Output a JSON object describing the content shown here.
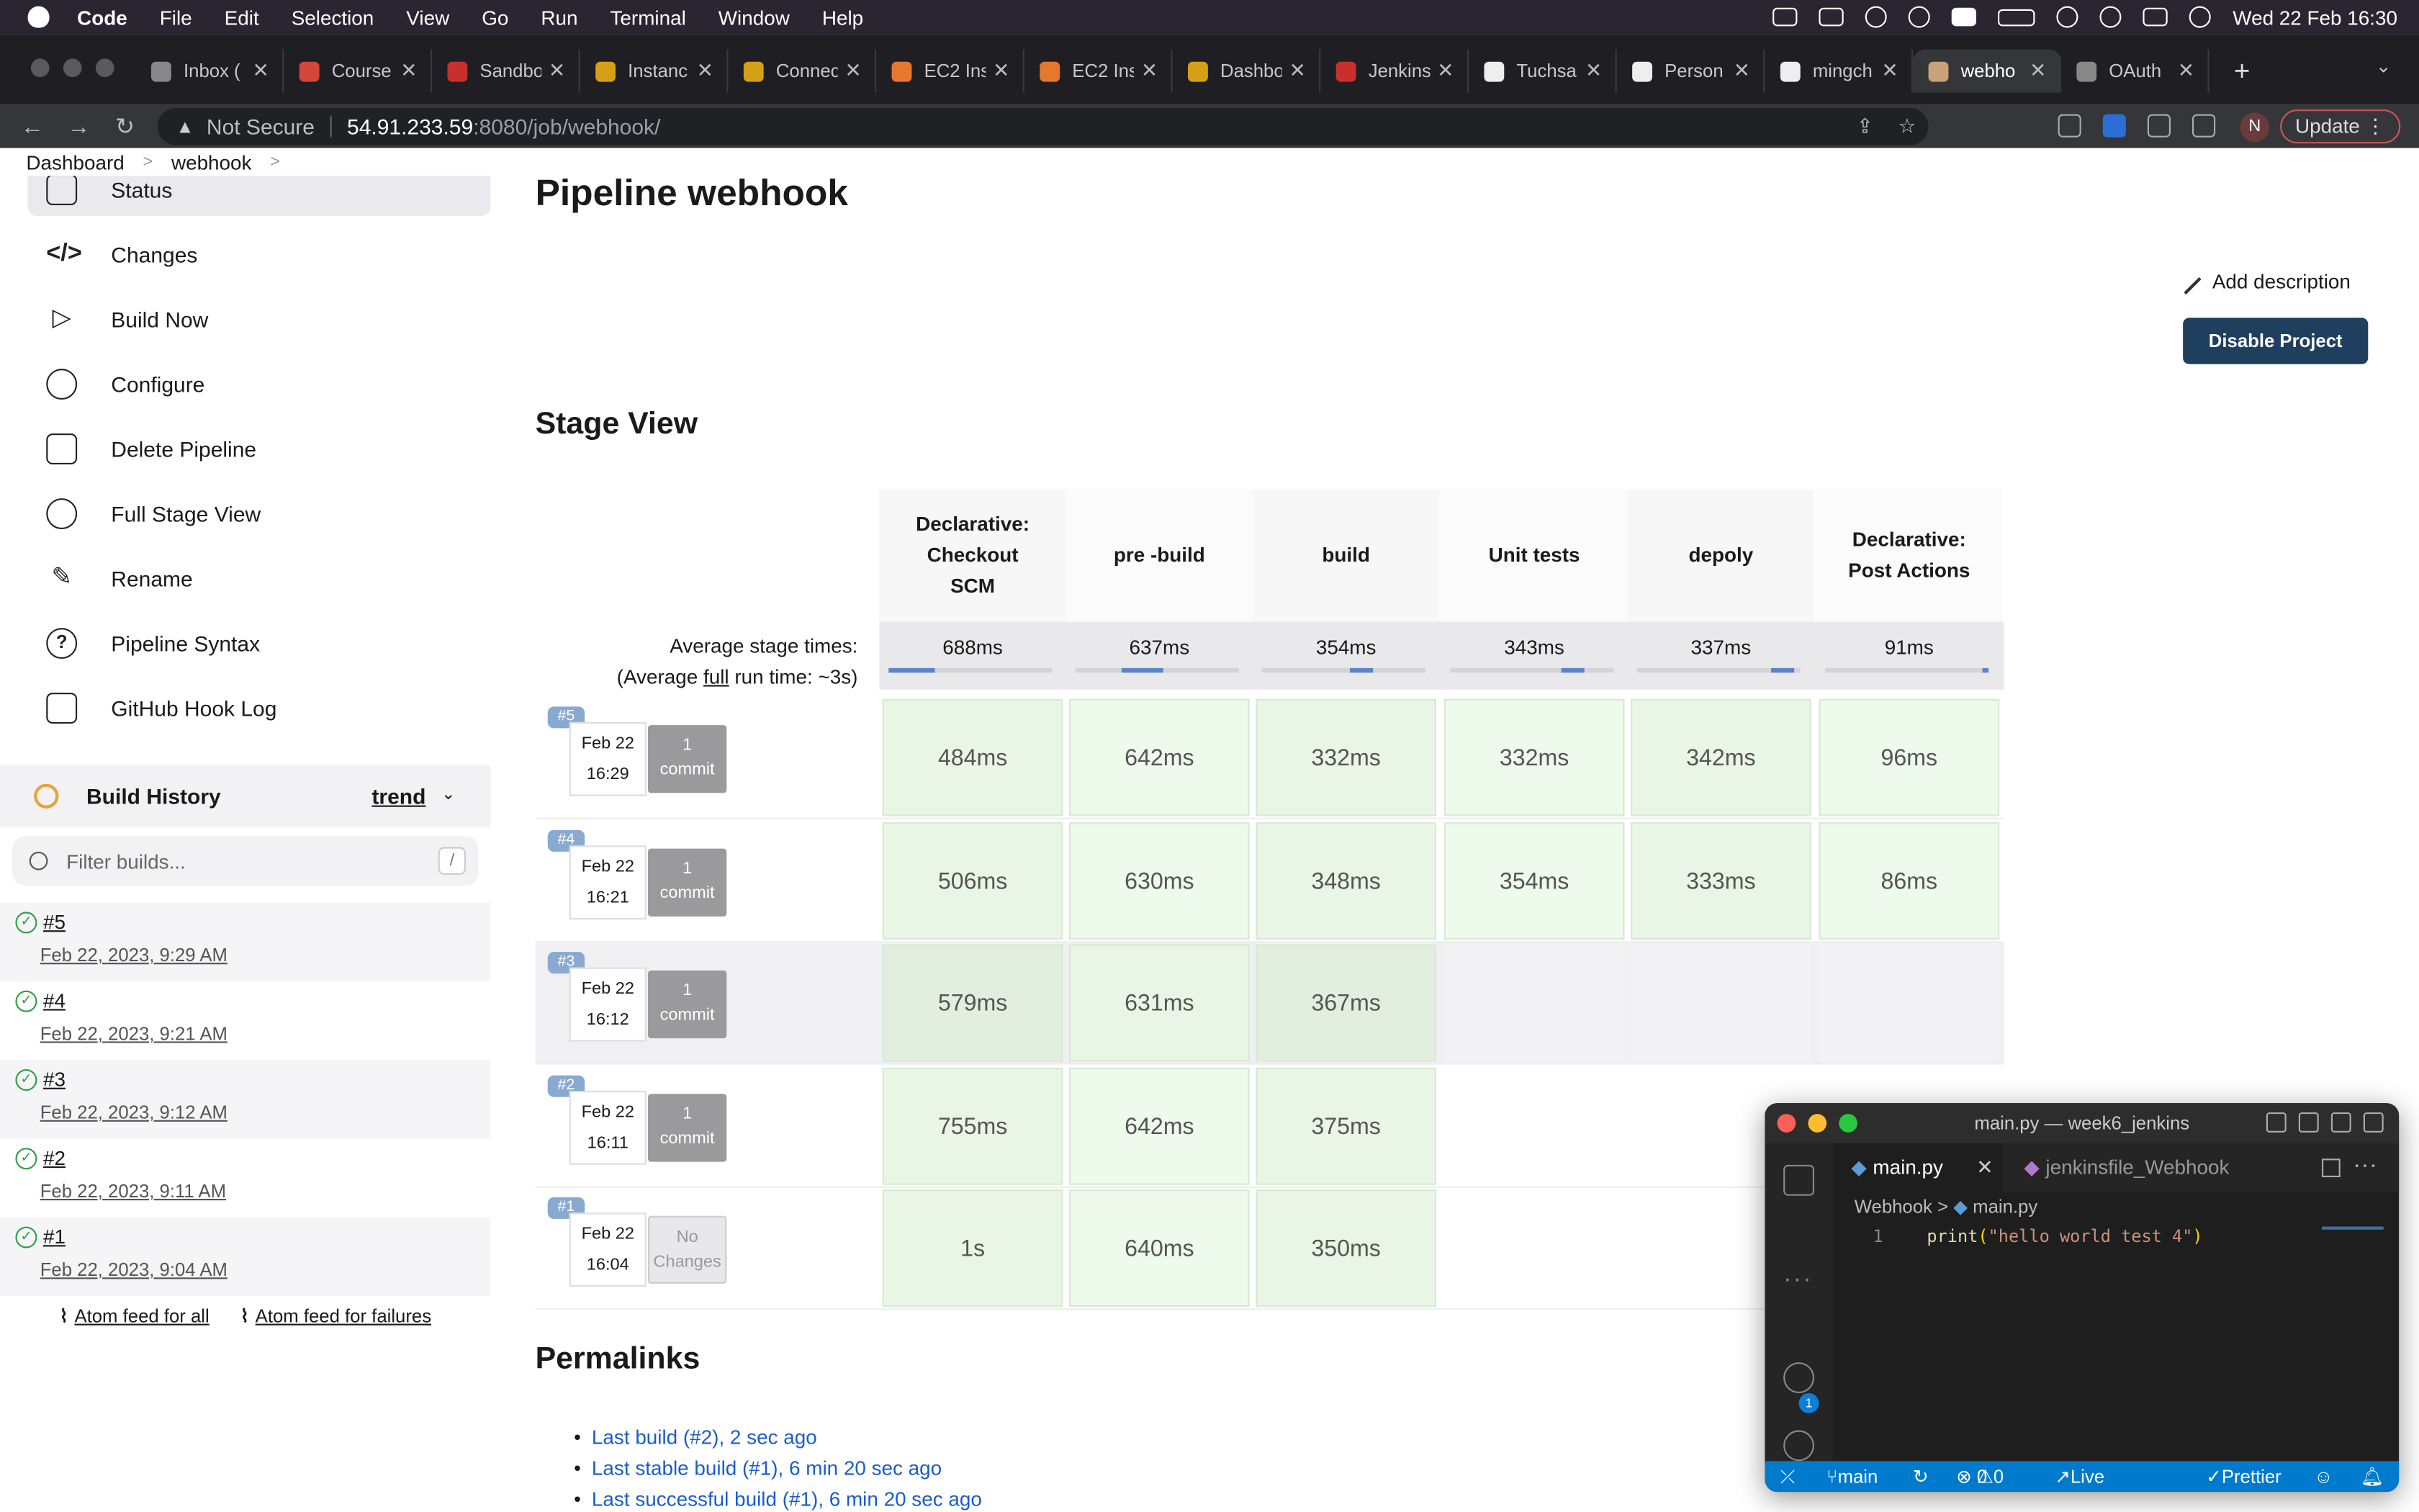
{
  "menubar": {
    "app": "Code",
    "items": [
      "File",
      "Edit",
      "Selection",
      "View",
      "Go",
      "Run",
      "Terminal",
      "Window",
      "Help"
    ],
    "clock": "Wed 22 Feb  16:30"
  },
  "browser": {
    "tabs": [
      {
        "label": "Inbox (",
        "color": "#888888"
      },
      {
        "label": "Course",
        "color": "#d44638"
      },
      {
        "label": "Sandbo",
        "color": "#c9302c"
      },
      {
        "label": "Instanc",
        "color": "#d4a017"
      },
      {
        "label": "Connec",
        "color": "#d4a017"
      },
      {
        "label": "EC2 Ins",
        "color": "#e8772e"
      },
      {
        "label": "EC2 Ins",
        "color": "#e8772e"
      },
      {
        "label": "Dashbo",
        "color": "#d4a017"
      },
      {
        "label": "Jenkins",
        "color": "#c9302c"
      },
      {
        "label": "Tuchsa",
        "color": "#eeeeee"
      },
      {
        "label": "Person",
        "color": "#eeeeee"
      },
      {
        "label": "mingch",
        "color": "#eeeeee"
      },
      {
        "label": "webho",
        "color": "#c9a27a",
        "active": true
      },
      {
        "label": "OAuth",
        "color": "#888888"
      }
    ],
    "security": "Not Secure",
    "url_host": "54.91.233.59",
    "url_path": ":8080/job/webhook/",
    "profile_initial": "N",
    "update_label": "Update"
  },
  "breadcrumb": [
    "Dashboard",
    "webhook"
  ],
  "sidebar": {
    "items": [
      {
        "label": "Status",
        "icon": "document-icon"
      },
      {
        "label": "Changes",
        "icon": "code-icon"
      },
      {
        "label": "Build Now",
        "icon": "play-icon"
      },
      {
        "label": "Configure",
        "icon": "gear-icon"
      },
      {
        "label": "Delete Pipeline",
        "icon": "trash-icon"
      },
      {
        "label": "Full Stage View",
        "icon": "search-icon"
      },
      {
        "label": "Rename",
        "icon": "pencil-icon"
      },
      {
        "label": "Pipeline Syntax",
        "icon": "help-icon"
      },
      {
        "label": "GitHub Hook Log",
        "icon": "clipboard-icon"
      }
    ],
    "build_history": {
      "title": "Build History",
      "trend": "trend",
      "filter_placeholder": "Filter builds...",
      "filter_shortcut": "/",
      "builds": [
        {
          "num": "#5",
          "date": "Feb 22, 2023, 9:29 AM"
        },
        {
          "num": "#4",
          "date": "Feb 22, 2023, 9:21 AM"
        },
        {
          "num": "#3",
          "date": "Feb 22, 2023, 9:12 AM"
        },
        {
          "num": "#2",
          "date": "Feb 22, 2023, 9:11 AM"
        },
        {
          "num": "#1",
          "date": "Feb 22, 2023, 9:04 AM"
        }
      ],
      "atom_all": "Atom feed for all",
      "atom_failures": "Atom feed for failures"
    }
  },
  "main": {
    "title": "Pipeline webhook",
    "add_description": "Add description",
    "disable_button": "Disable Project",
    "stage_view_title": "Stage View",
    "avg_label_1": "Average stage times:",
    "avg_label_2a": "(Average ",
    "avg_label_2b": "full",
    "avg_label_2c": " run time: ~3s)",
    "stages": [
      {
        "name": "Declarative: Checkout SCM",
        "avg": "688ms",
        "bar": 0.28
      },
      {
        "name": "pre -build",
        "avg": "637ms",
        "bar": 0.26
      },
      {
        "name": "build",
        "avg": "354ms",
        "bar": 0.14
      },
      {
        "name": "Unit tests",
        "avg": "343ms",
        "bar": 0.14
      },
      {
        "name": "depoly",
        "avg": "337ms",
        "bar": 0.14
      },
      {
        "name": "Declarative: Post Actions",
        "avg": "91ms",
        "bar": 0.04
      }
    ],
    "runs": [
      {
        "badge": "#5",
        "date": "Feb 22",
        "time": "16:29",
        "commits": "1",
        "commit_word": "commit",
        "cells": [
          "484ms",
          "642ms",
          "332ms",
          "332ms",
          "342ms",
          "96ms"
        ]
      },
      {
        "badge": "#4",
        "date": "Feb 22",
        "time": "16:21",
        "commits": "1",
        "commit_word": "commit",
        "cells": [
          "506ms",
          "630ms",
          "348ms",
          "354ms",
          "333ms",
          "86ms"
        ]
      },
      {
        "badge": "#3",
        "date": "Feb 22",
        "time": "16:12",
        "commits": "1",
        "commit_word": "commit",
        "cells": [
          "579ms",
          "631ms",
          "367ms",
          "",
          "",
          ""
        ]
      },
      {
        "badge": "#2",
        "date": "Feb 22",
        "time": "16:11",
        "commits": "1",
        "commit_word": "commit",
        "cells": [
          "755ms",
          "642ms",
          "375ms",
          "",
          "",
          ""
        ]
      },
      {
        "badge": "#1",
        "date": "Feb 22",
        "time": "16:04",
        "commits": "No",
        "commit_word": "Changes",
        "cells": [
          "1s",
          "640ms",
          "350ms",
          "",
          "",
          ""
        ]
      }
    ],
    "permalinks_title": "Permalinks",
    "permalinks": [
      "Last build (#2), 2 sec ago",
      "Last stable build (#1), 6 min 20 sec ago",
      "Last successful build (#1), 6 min 20 sec ago"
    ]
  },
  "vscode": {
    "title": "main.py — week6_jenkins",
    "tab_active": "main.py",
    "tab_other": "jenkinsfile_Webhook",
    "crumb_folder": "Webhook",
    "crumb_file": "main.py",
    "line_no": "1",
    "code_fn": "print",
    "code_str": "\"hello world test 4\"",
    "accounts_badge": "1",
    "status_branch": "main",
    "status_problems": "0",
    "status_warnings": "0",
    "status_liveshare": "Live Share",
    "status_prettier": "Prettier"
  }
}
